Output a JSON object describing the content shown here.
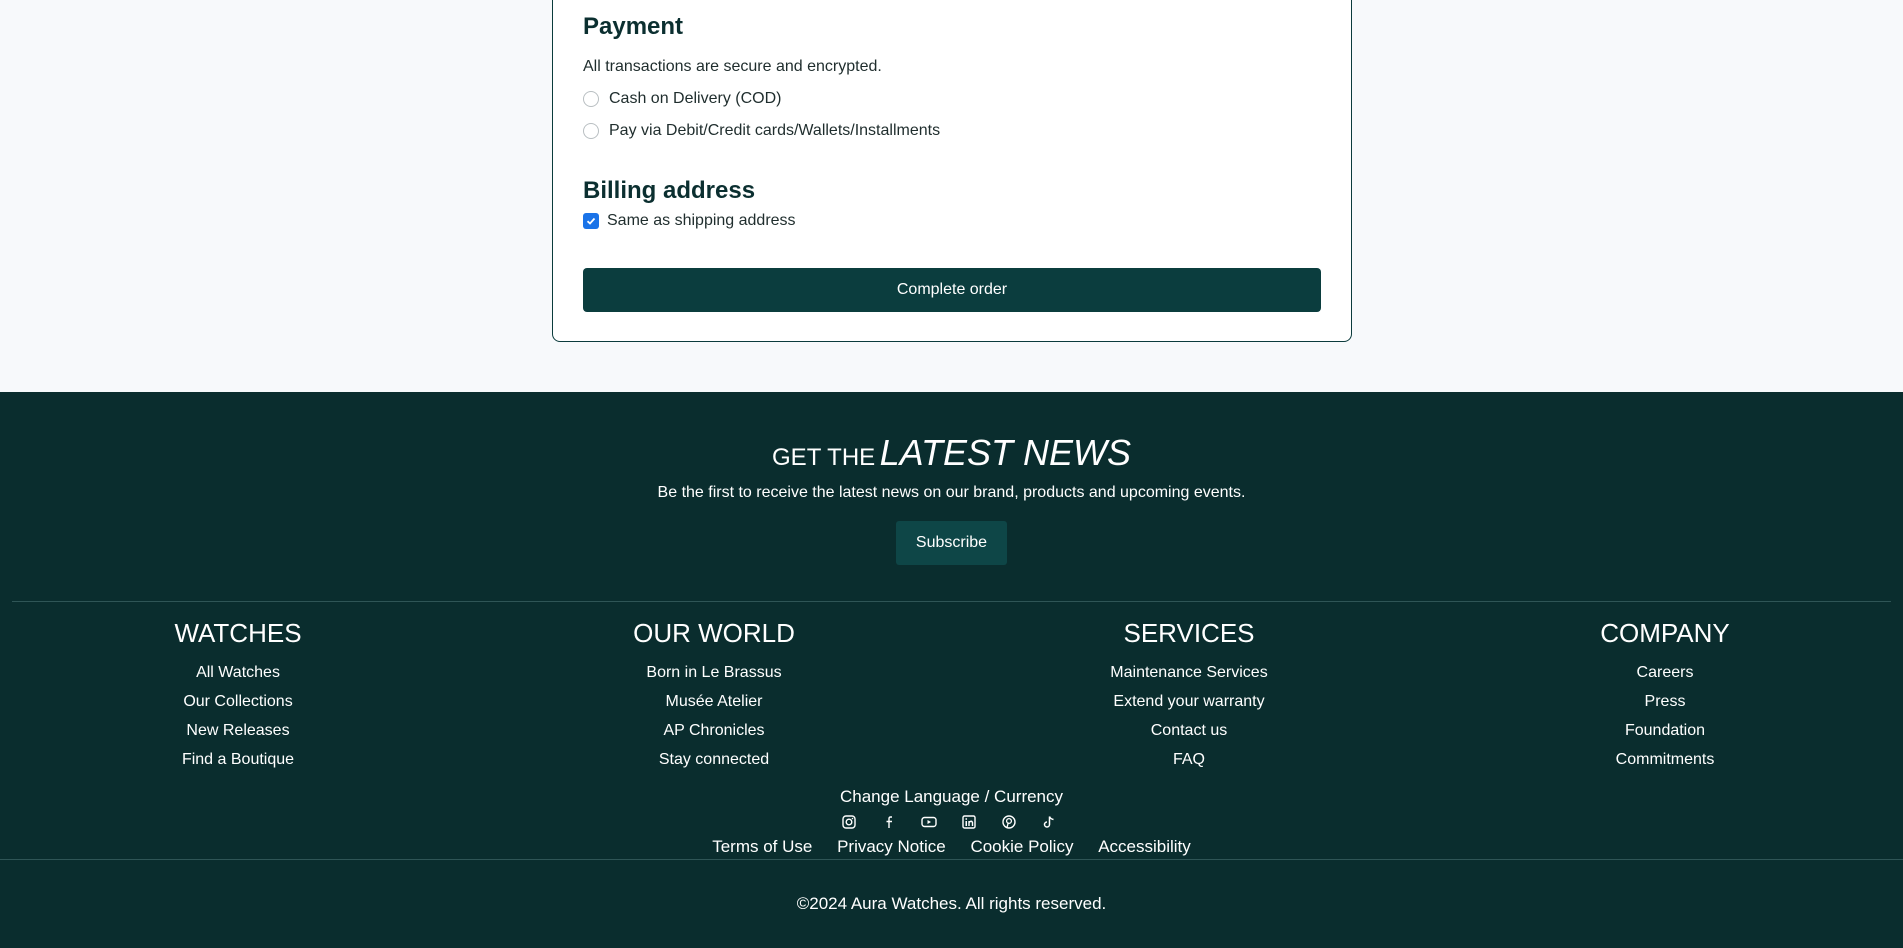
{
  "payment": {
    "title": "Payment",
    "subtitle": "All transactions are secure and encrypted.",
    "options": [
      "Cash on Delivery (COD)",
      "Pay via Debit/Credit cards/Wallets/Installments"
    ]
  },
  "billing": {
    "title": "Billing address",
    "same_as_shipping": "Same as shipping address"
  },
  "complete_button": "Complete order",
  "newsletter": {
    "title_a": "GET THE",
    "title_b": "LATEST NEWS",
    "description": "Be the first to receive the latest news on our brand, products and upcoming events.",
    "subscribe": "Subscribe"
  },
  "footer_columns": [
    {
      "title": "WATCHES",
      "links": [
        "All Watches",
        "Our Collections",
        "New Releases",
        "Find a Boutique"
      ]
    },
    {
      "title": "OUR WORLD",
      "links": [
        "Born in Le Brassus",
        "Musée Atelier",
        "AP Chronicles",
        "Stay connected"
      ]
    },
    {
      "title": "SERVICES",
      "links": [
        "Maintenance Services",
        "Extend your warranty",
        "Contact us",
        "FAQ"
      ]
    },
    {
      "title": "COMPANY",
      "links": [
        "Careers",
        "Press",
        "Foundation",
        "Commitments"
      ]
    }
  ],
  "language_currency": "Change Language / Currency",
  "socials": [
    "instagram-icon",
    "facebook-icon",
    "youtube-icon",
    "linkedin-icon",
    "pinterest-icon",
    "tiktok-icon"
  ],
  "legal_links": [
    "Terms of Use",
    "Privacy Notice",
    "Cookie Policy",
    "Accessibility"
  ],
  "copyright": "©2024 Aura Watches. All rights reserved.",
  "colors": {
    "footer_bg": "#0a2d2e",
    "button": "#0b3d3e",
    "checkbox": "#1a73e8"
  }
}
